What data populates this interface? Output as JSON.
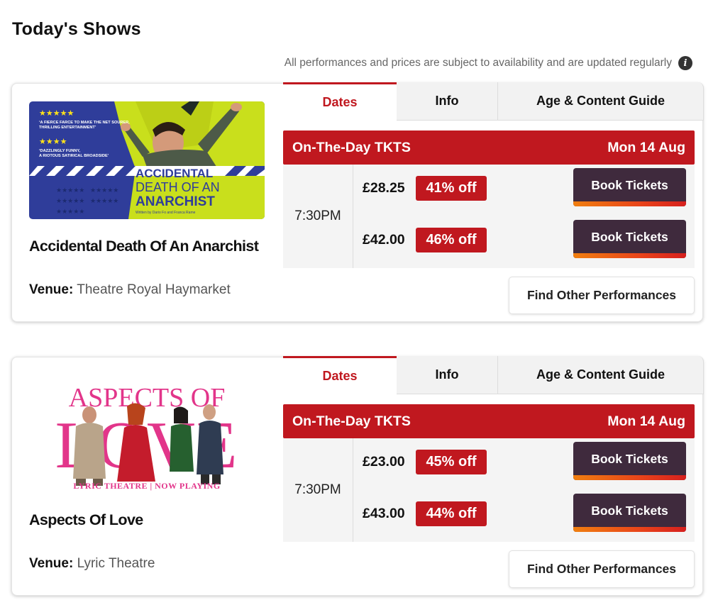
{
  "page": {
    "title": "Today's Shows",
    "notice": "All performances and prices are subject to availability and are updated regularly",
    "info_icon": "i"
  },
  "tabs": {
    "dates": "Dates",
    "info": "Info",
    "age": "Age & Content Guide"
  },
  "colors": {
    "accent_red": "#c0181f",
    "book_button": "#3f2a3d",
    "book_stripe_start": "#f07f10",
    "book_stripe_end": "#d6201e"
  },
  "shows": [
    {
      "title": "Accidental Death Of An Anarchist",
      "venue_label": "Venue:",
      "venue": "Theatre Royal Haymarket",
      "banner_label": "On-The-Day TKTS",
      "banner_date": "Mon 14 Aug",
      "time": "7:30PM",
      "poster": {
        "stars_top": "★★★★★",
        "quote_1a": "‘A FIERCE FARCE TO MAKE THE NET SOURER,",
        "quote_1b": "THRILLING ENTERTAINMENT’",
        "stars_mid": "★★★★",
        "quote_2a": "‘DAZZLINGLY FUNNY,",
        "quote_2b": "A RIOTOUS SATIRICAL BROADSIDE’",
        "stars_row": "★★★★★",
        "stars_row2": "★★★★★",
        "title_1": "ACCIDENTAL",
        "title_2": "DEATH OF AN",
        "title_3": "ANARCHIST",
        "credit": "Written by Dario Fo and Franca Rame"
      },
      "prices": [
        {
          "price": "£28.25",
          "discount": "41% off",
          "button": "Book Tickets"
        },
        {
          "price": "£42.00",
          "discount": "46% off",
          "button": "Book Tickets"
        }
      ],
      "find_label": "Find Other Performances"
    },
    {
      "title": "Aspects Of Love",
      "venue_label": "Venue:",
      "venue": "Lyric Theatre",
      "banner_label": "On-The-Day TKTS",
      "banner_date": "Mon 14 Aug",
      "time": "7:30PM",
      "poster": {
        "title_1": "ASPECTS OF",
        "title_2": "LOVE",
        "footer": "LYRIC THEATRE | NOW PLAYING"
      },
      "prices": [
        {
          "price": "£23.00",
          "discount": "45% off",
          "button": "Book Tickets"
        },
        {
          "price": "£43.00",
          "discount": "44% off",
          "button": "Book Tickets"
        }
      ],
      "find_label": "Find Other Performances"
    }
  ]
}
